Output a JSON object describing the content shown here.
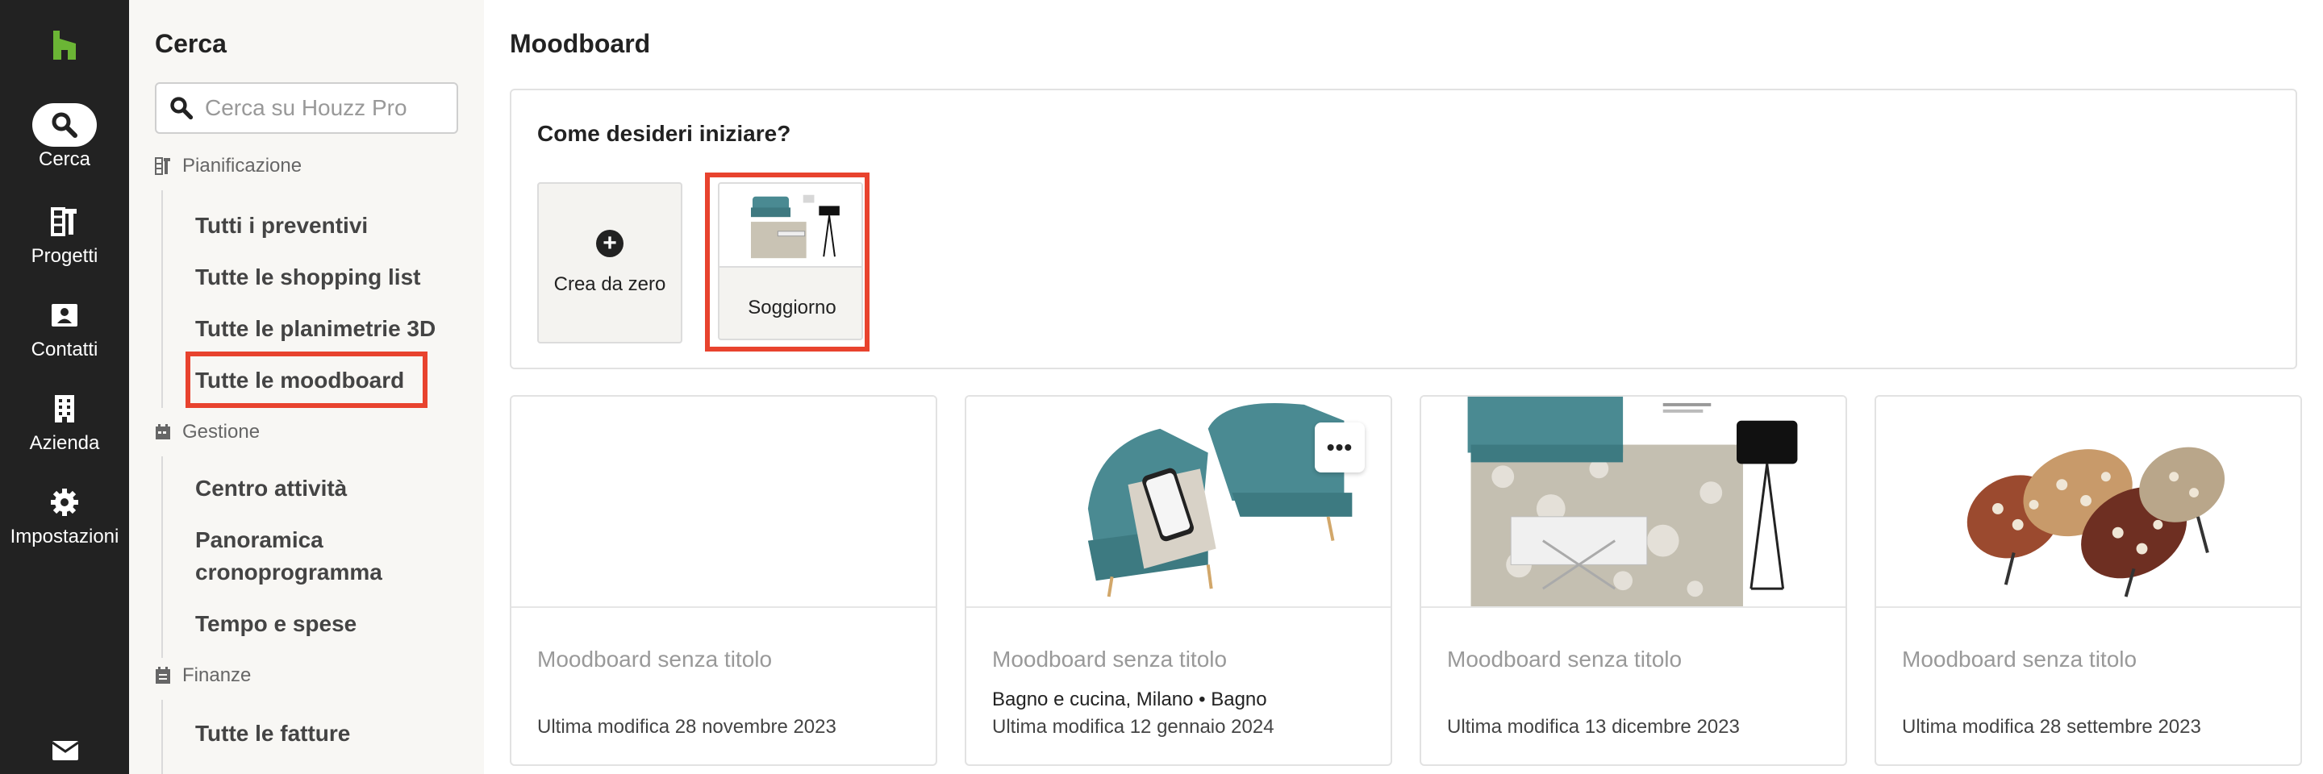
{
  "rail": {
    "items": [
      {
        "label": "Cerca",
        "icon": "search-icon",
        "active": true
      },
      {
        "label": "Progetti",
        "icon": "projects-icon"
      },
      {
        "label": "Contatti",
        "icon": "contacts-icon"
      },
      {
        "label": "Azienda",
        "icon": "building-icon"
      },
      {
        "label": "Impostazioni",
        "icon": "gear-icon"
      }
    ],
    "accent": "#6bb535"
  },
  "panel": {
    "title": "Cerca",
    "search_placeholder": "Cerca su Houzz Pro",
    "sections": [
      {
        "label": "Pianificazione",
        "items": [
          "Tutti i preventivi",
          "Tutte le shopping list",
          "Tutte le planimetrie 3D",
          "Tutte le moodboard"
        ]
      },
      {
        "label": "Gestione",
        "items": [
          "Centro attività",
          "Panoramica",
          "cronoprogramma",
          "Tempo e spese"
        ]
      },
      {
        "label": "Finanze",
        "items": [
          "Tutte le fatture"
        ]
      }
    ],
    "selected": "Tutte le moodboard"
  },
  "main": {
    "title": "Moodboard",
    "start": {
      "question": "Come desideri iniziare?",
      "new_label": "Crea da zero",
      "template_label": "Soggiorno"
    },
    "cards": [
      {
        "title": "Moodboard senza titolo",
        "location": "",
        "date": "Ultima modifica 28 novembre 2023"
      },
      {
        "title": "Moodboard senza titolo",
        "location": "Bagno e cucina, Milano • Bagno",
        "date": "Ultima modifica 12 gennaio 2024",
        "more": "•••"
      },
      {
        "title": "Moodboard senza titolo",
        "location": "",
        "date": "Ultima modifica 13 dicembre 2023"
      },
      {
        "title": "Moodboard senza titolo",
        "location": "",
        "date": "Ultima modifica 28 settembre 2023"
      }
    ]
  },
  "colors": {
    "highlight": "#e8432e",
    "rail_bg": "#222222",
    "panel_bg": "#f8f7f4",
    "teal": "#4a8a92"
  }
}
